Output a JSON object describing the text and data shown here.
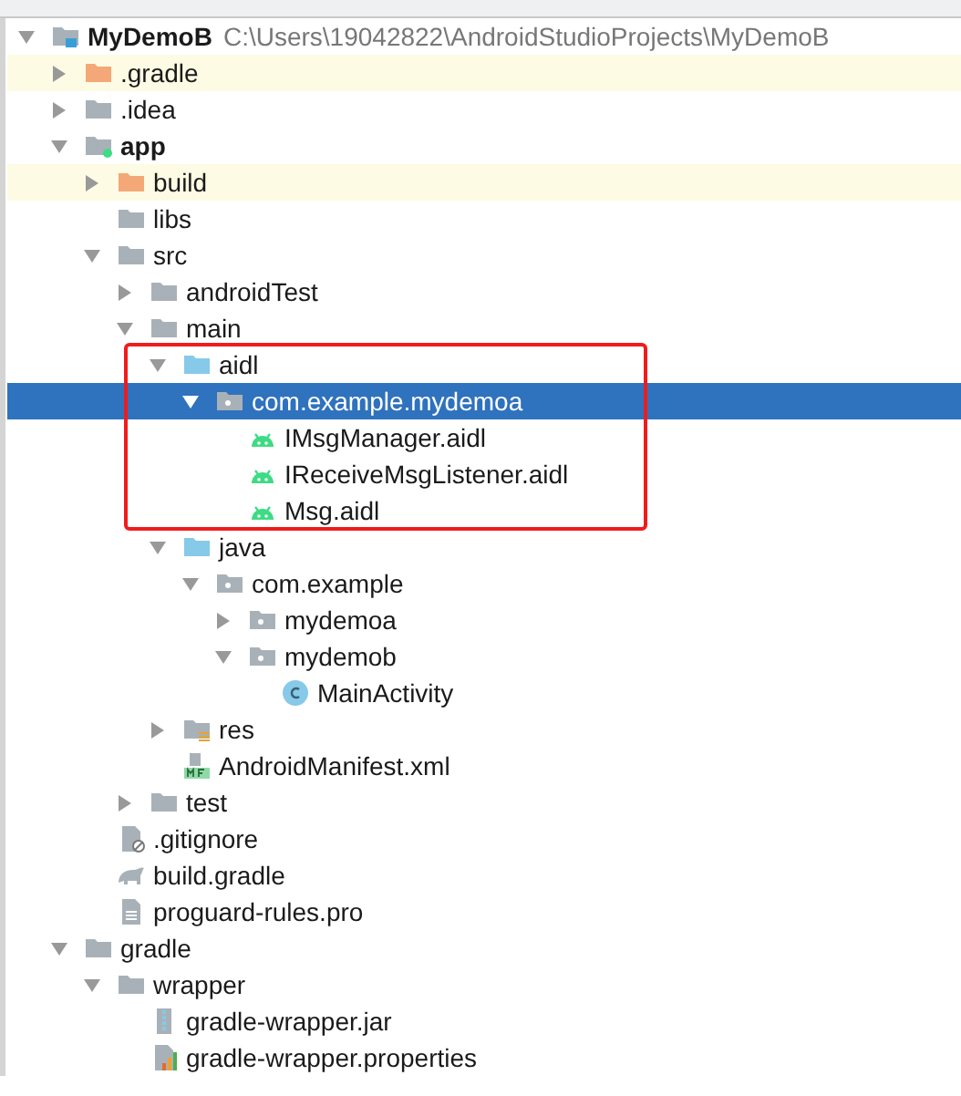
{
  "tree": [
    {
      "label": "MyDemoB",
      "path": "C:\\Users\\19042822\\AndroidStudioProjects\\MyDemoB",
      "kind": "project",
      "expanded": true,
      "selected": false,
      "excluded": false,
      "children": [
        {
          "label": ".gradle",
          "kind": "folder-excluded",
          "expanded": false,
          "selected": false,
          "excluded": true
        },
        {
          "label": ".idea",
          "kind": "folder",
          "expanded": false,
          "selected": false,
          "excluded": false
        },
        {
          "label": "app",
          "kind": "module",
          "expanded": true,
          "selected": false,
          "excluded": false,
          "children": [
            {
              "label": "build",
              "kind": "folder-excluded",
              "expanded": false,
              "selected": false,
              "excluded": true
            },
            {
              "label": "libs",
              "kind": "folder",
              "selected": false,
              "excluded": false
            },
            {
              "label": "src",
              "kind": "folder",
              "expanded": true,
              "selected": false,
              "excluded": false,
              "children": [
                {
                  "label": "androidTest",
                  "kind": "folder",
                  "expanded": false,
                  "selected": false,
                  "excluded": false
                },
                {
                  "label": "main",
                  "kind": "folder",
                  "expanded": true,
                  "selected": false,
                  "excluded": false,
                  "children": [
                    {
                      "label": "aidl",
                      "kind": "folder-source",
                      "expanded": true,
                      "selected": false,
                      "excluded": false,
                      "children": [
                        {
                          "label": "com.example.mydemoa",
                          "kind": "package",
                          "expanded": true,
                          "selected": true,
                          "excluded": false,
                          "children": [
                            {
                              "label": "IMsgManager.aidl",
                              "kind": "android",
                              "selected": false,
                              "excluded": false
                            },
                            {
                              "label": "IReceiveMsgListener.aidl",
                              "kind": "android",
                              "selected": false,
                              "excluded": false
                            },
                            {
                              "label": "Msg.aidl",
                              "kind": "android",
                              "selected": false,
                              "excluded": false
                            }
                          ]
                        }
                      ]
                    },
                    {
                      "label": "java",
                      "kind": "folder-source",
                      "expanded": true,
                      "selected": false,
                      "excluded": false,
                      "children": [
                        {
                          "label": "com.example",
                          "kind": "package",
                          "expanded": true,
                          "selected": false,
                          "excluded": false,
                          "children": [
                            {
                              "label": "mydemoa",
                              "kind": "package",
                              "expanded": false,
                              "selected": false,
                              "excluded": false
                            },
                            {
                              "label": "mydemob",
                              "kind": "package",
                              "expanded": true,
                              "selected": false,
                              "excluded": false,
                              "children": [
                                {
                                  "label": "MainActivity",
                                  "kind": "class",
                                  "selected": false,
                                  "excluded": false
                                }
                              ]
                            }
                          ]
                        }
                      ]
                    },
                    {
                      "label": "res",
                      "kind": "res",
                      "expanded": false,
                      "selected": false,
                      "excluded": false
                    },
                    {
                      "label": "AndroidManifest.xml",
                      "kind": "manifest",
                      "selected": false,
                      "excluded": false
                    }
                  ]
                },
                {
                  "label": "test",
                  "kind": "folder",
                  "expanded": false,
                  "selected": false,
                  "excluded": false
                }
              ]
            },
            {
              "label": ".gitignore",
              "kind": "ignore",
              "selected": false,
              "excluded": false
            },
            {
              "label": "build.gradle",
              "kind": "gradle",
              "selected": false,
              "excluded": false
            },
            {
              "label": "proguard-rules.pro",
              "kind": "text",
              "selected": false,
              "excluded": false
            }
          ]
        },
        {
          "label": "gradle",
          "kind": "folder",
          "expanded": true,
          "selected": false,
          "excluded": false,
          "children": [
            {
              "label": "wrapper",
              "kind": "folder",
              "expanded": true,
              "selected": false,
              "excluded": false,
              "children": [
                {
                  "label": "gradle-wrapper.jar",
                  "kind": "jar",
                  "selected": false,
                  "excluded": false
                },
                {
                  "label": "gradle-wrapper.properties",
                  "kind": "properties",
                  "selected": false,
                  "excluded": false
                }
              ]
            }
          ]
        }
      ]
    }
  ]
}
